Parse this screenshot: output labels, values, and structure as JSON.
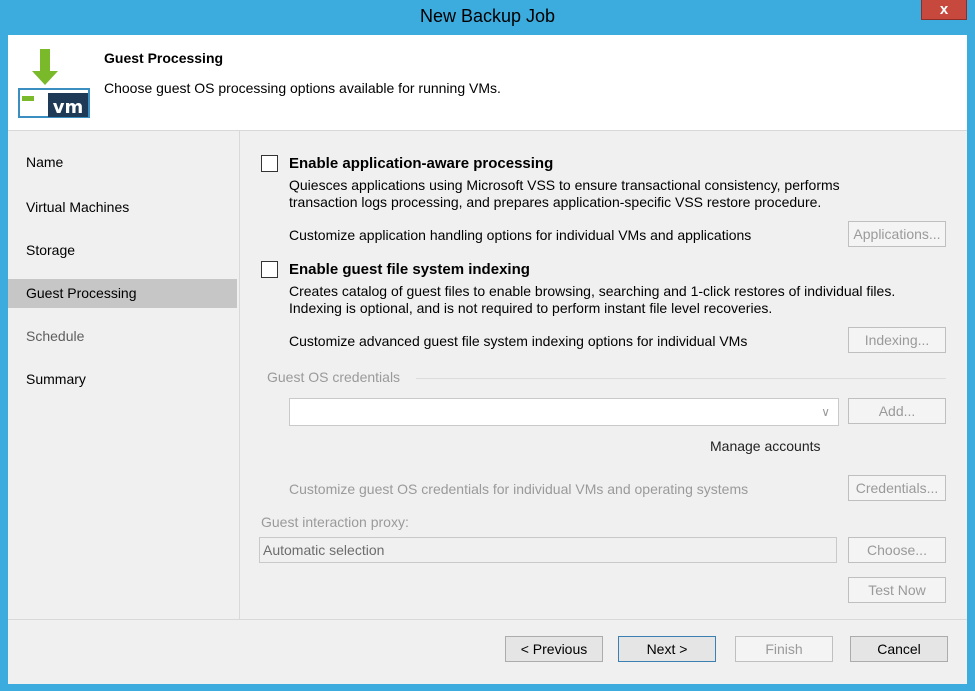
{
  "window": {
    "title": "New Backup Job",
    "close_glyph": "x"
  },
  "header": {
    "title": "Guest Processing",
    "subtitle": "Choose guest OS processing options available for running VMs.",
    "icon_text": "vm",
    "icon": "vm-download-icon"
  },
  "sidebar": {
    "items": [
      {
        "label": "Name",
        "state": "enabled"
      },
      {
        "label": "Virtual Machines",
        "state": "enabled"
      },
      {
        "label": "Storage",
        "state": "enabled"
      },
      {
        "label": "Guest Processing",
        "state": "active"
      },
      {
        "label": "Schedule",
        "state": "disabled"
      },
      {
        "label": "Summary",
        "state": "enabled"
      }
    ]
  },
  "app_aware": {
    "label": "Enable application-aware processing",
    "checked": false,
    "desc_line1": "Quiesces applications using Microsoft VSS to ensure transactional consistency, performs",
    "desc_line2": "transaction logs processing, and prepares application-specific VSS restore procedure.",
    "customize_text": "Customize application handling options for individual VMs and applications",
    "button": "Applications..."
  },
  "indexing": {
    "label": "Enable guest file system indexing",
    "checked": false,
    "desc_line1": "Creates catalog of guest files to enable browsing, searching and 1-click restores of individual files.",
    "desc_line2": "Indexing is optional, and is not required to perform instant file level recoveries.",
    "customize_text": "Customize advanced guest file system indexing options for individual VMs",
    "button": "Indexing..."
  },
  "credentials": {
    "group_label": "Guest OS credentials",
    "combo_value": "",
    "add_button": "Add...",
    "manage_link": "Manage accounts",
    "customize_text": "Customize guest OS credentials for individual VMs and operating systems",
    "button": "Credentials..."
  },
  "proxy": {
    "label": "Guest interaction proxy:",
    "value": "Automatic selection",
    "choose_button": "Choose...",
    "test_button": "Test Now"
  },
  "footer": {
    "previous": "< Previous",
    "next": "Next >",
    "finish": "Finish",
    "cancel": "Cancel"
  },
  "colors": {
    "window_frame": "#3cabde",
    "icon_green": "#7ab929",
    "active_nav": "#c6c6c6"
  }
}
